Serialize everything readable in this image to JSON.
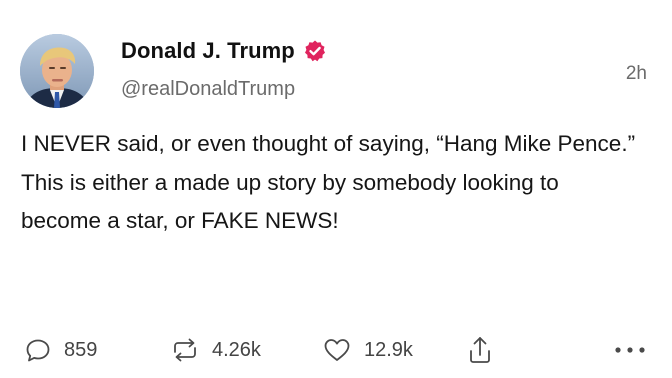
{
  "post": {
    "author": {
      "display_name": "Donald J. Trump",
      "handle": "@realDonaldTrump",
      "verified": true,
      "verified_color": "#e0245e",
      "avatar_icon": "profile-photo"
    },
    "timestamp": "2h",
    "text": "I NEVER said, or even thought of saying, “Hang Mike Pence.” This is either a made up story by somebody looking to become a star, or FAKE NEWS!",
    "actions": {
      "reply": {
        "icon": "speech-bubble-icon",
        "count": "859"
      },
      "repost": {
        "icon": "repost-arrows-icon",
        "count": "4.26k"
      },
      "like": {
        "icon": "heart-icon",
        "count": "12.9k"
      },
      "share": {
        "icon": "share-arrow-icon"
      },
      "more": {
        "icon": "ellipsis-icon"
      }
    }
  }
}
